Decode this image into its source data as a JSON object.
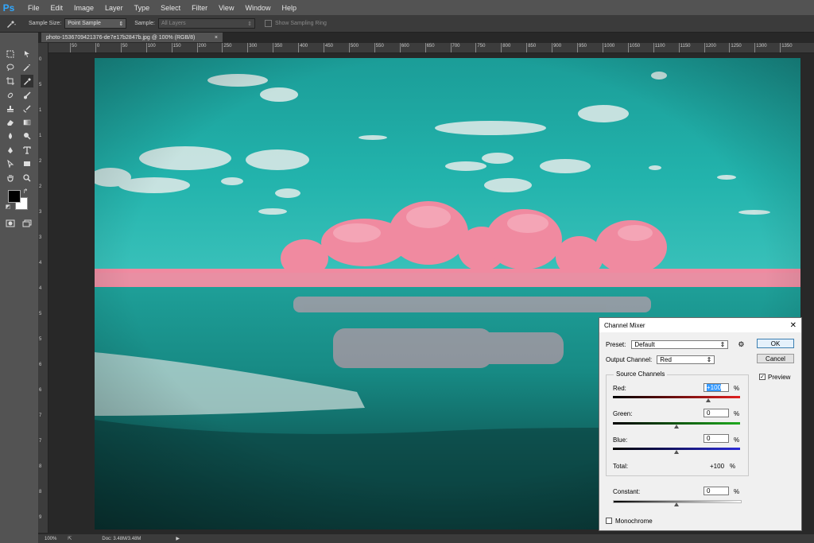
{
  "app": {
    "logo": "Ps"
  },
  "menu": [
    "File",
    "Edit",
    "Image",
    "Layer",
    "Type",
    "Select",
    "Filter",
    "View",
    "Window",
    "Help"
  ],
  "options": {
    "tool_icon": "eyedropper-icon",
    "sample_size_label": "Sample Size:",
    "sample_size_value": "Point Sample",
    "sample_label": "Sample:",
    "sample_value": "All Layers",
    "show_ring_label": "Show Sampling Ring"
  },
  "document": {
    "tab_title": "photo-1536709421376-de7e17b2847b.jpg @ 100% (RGB/8)",
    "close_glyph": "×"
  },
  "ruler": {
    "top": [
      "50",
      "0",
      "50",
      "100",
      "150",
      "200",
      "250",
      "300",
      "350",
      "400",
      "450",
      "500",
      "550",
      "600",
      "650",
      "700",
      "750",
      "800",
      "850",
      "900",
      "950",
      "1000",
      "1050",
      "1100",
      "1150",
      "1200",
      "1250",
      "1300",
      "1350"
    ],
    "left": [
      "0",
      "5",
      "1",
      "1",
      "2",
      "2",
      "3",
      "3",
      "4",
      "4",
      "5",
      "5",
      "6",
      "6",
      "7",
      "7",
      "8",
      "8",
      "9"
    ]
  },
  "status": {
    "zoom": "100%",
    "doc": "Doc: 3.48M/3.48M",
    "arrow": "▶"
  },
  "channel_mixer": {
    "title": "Channel Mixer",
    "close_glyph": "✕",
    "preset_label": "Preset:",
    "preset_value": "Default",
    "output_label": "Output Channel:",
    "output_value": "Red",
    "ok_label": "OK",
    "cancel_label": "Cancel",
    "preview_label": "Preview",
    "preview_checked": true,
    "source_group_label": "Source Channels",
    "red_label": "Red:",
    "red_value": "+100",
    "red_slider": 100,
    "green_label": "Green:",
    "green_value": "0",
    "green_slider": 0,
    "blue_label": "Blue:",
    "blue_value": "0",
    "blue_slider": 0,
    "total_label": "Total:",
    "total_value": "+100",
    "constant_label": "Constant:",
    "constant_value": "0",
    "constant_slider": 0,
    "percent": "%",
    "monochrome_label": "Monochrome",
    "monochrome_checked": false
  }
}
